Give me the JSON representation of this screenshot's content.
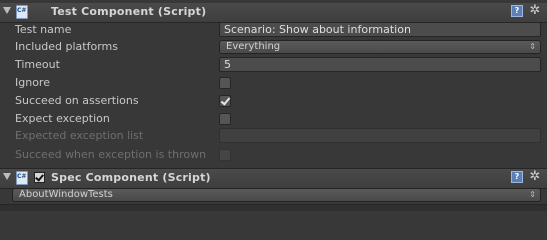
{
  "test_component": {
    "title": "Test Component (Script)",
    "fields": {
      "test_name": {
        "label": "Test name",
        "value": "Scenario: Show about information"
      },
      "included_platforms": {
        "label": "Included platforms",
        "value": "Everything"
      },
      "timeout": {
        "label": "Timeout",
        "value": "5"
      },
      "ignore": {
        "label": "Ignore",
        "checked": false
      },
      "succeed_on_assertions": {
        "label": "Succeed on assertions",
        "checked": true
      },
      "expect_exception": {
        "label": "Expect exception",
        "checked": false
      },
      "expected_exception_list": {
        "label": "Expected exception list",
        "value": ""
      },
      "succeed_when_exception_thrown": {
        "label": "Succeed when exception is thrown",
        "checked": false
      }
    }
  },
  "spec_component": {
    "title": "Spec Component (Script)",
    "enabled": true,
    "selected": "AboutWindowTests"
  },
  "icons": {
    "foldout": "foldout-arrow-icon",
    "script": "csharp-script-icon",
    "help": "help-icon",
    "gear": "gear-icon"
  },
  "glyphs": {
    "help": "?",
    "gear": "✲",
    "arrows": "⇕"
  }
}
